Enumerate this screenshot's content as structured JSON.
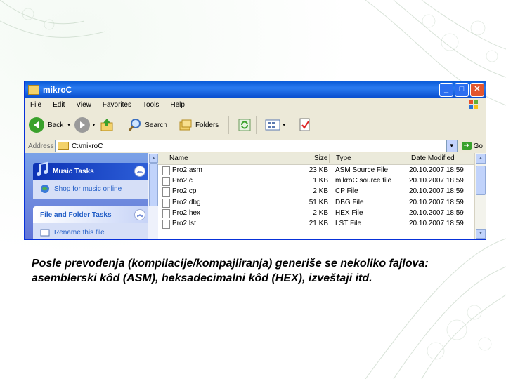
{
  "window": {
    "title": "mikroC",
    "buttons": {
      "minimize": "_",
      "maximize": "□",
      "close": "✕"
    }
  },
  "menu": [
    "File",
    "Edit",
    "View",
    "Favorites",
    "Tools",
    "Help"
  ],
  "toolbar": {
    "back_label": "Back",
    "search_label": "Search",
    "folders_label": "Folders"
  },
  "address": {
    "label": "Address",
    "value": "C:\\mikroC",
    "go_label": "Go"
  },
  "tasks": {
    "music_title": "Music Tasks",
    "music_item": "Shop for music online",
    "folder_title": "File and Folder Tasks",
    "folder_item": "Rename this file"
  },
  "columns": {
    "name": "Name",
    "size": "Size",
    "type": "Type",
    "date": "Date Modified"
  },
  "files": [
    {
      "name": "Pro2.asm",
      "size": "23 KB",
      "type": "ASM Source File",
      "date": "20.10.2007 18:59"
    },
    {
      "name": "Pro2.c",
      "size": "1 KB",
      "type": "mikroC source file",
      "date": "20.10.2007 18:59"
    },
    {
      "name": "Pro2.cp",
      "size": "2 KB",
      "type": "CP File",
      "date": "20.10.2007 18:59"
    },
    {
      "name": "Pro2.dbg",
      "size": "51 KB",
      "type": "DBG File",
      "date": "20.10.2007 18:59"
    },
    {
      "name": "Pro2.hex",
      "size": "2 KB",
      "type": "HEX File",
      "date": "20.10.2007 18:59"
    },
    {
      "name": "Pro2.lst",
      "size": "21 KB",
      "type": "LST File",
      "date": "20.10.2007 18:59"
    }
  ],
  "caption": {
    "line1": "Posle prevođenja (kompilacije/kompajliranja) generiše se nekoliko fajlova:",
    "line2": "asemblerski kôd (ASM), heksadecimalni kôd (HEX), izveštaji itd."
  },
  "colors": {
    "titlebar": "#0a5bd8",
    "taskpane": "#6375d6",
    "window_bg": "#ece9d8"
  }
}
